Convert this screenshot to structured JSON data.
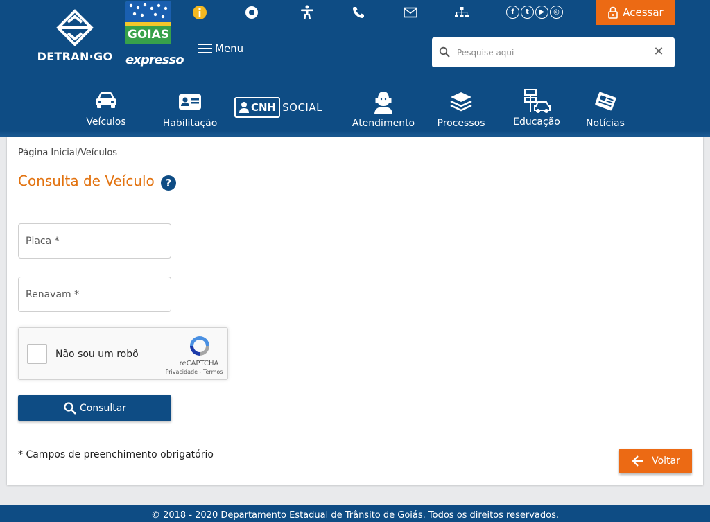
{
  "header": {
    "logo_detran_text": "DETRAN·GO",
    "logo_goias_text": "GOIAS",
    "logo_expresso_text": "expresso",
    "menu_label": "Menu",
    "acessar_label": "Acessar",
    "search": {
      "placeholder": "Pesquise aqui",
      "value": ""
    },
    "top_icons": [
      "info-icon",
      "location-icon",
      "accessibility-icon",
      "phone-icon",
      "mail-icon",
      "sitemap-icon"
    ],
    "social": [
      {
        "name": "facebook-icon",
        "glyph": "f"
      },
      {
        "name": "twitter-icon",
        "glyph": "t"
      },
      {
        "name": "youtube-icon",
        "glyph": "▶"
      },
      {
        "name": "instagram-icon",
        "glyph": "◎"
      }
    ],
    "nav": [
      {
        "label": "Veículos",
        "icon": "car-icon"
      },
      {
        "label": "Habilitação",
        "icon": "id-card-icon"
      },
      {
        "label": "CNH",
        "icon": "cnh-social-icon"
      },
      {
        "label": "SOCIAL",
        "icon": ""
      },
      {
        "label": "Atendimento",
        "icon": "attendant-icon"
      },
      {
        "label": "Processos",
        "icon": "layers-icon"
      },
      {
        "label": "Educação",
        "icon": "traffic-education-icon"
      },
      {
        "label": "Notícias",
        "icon": "newspaper-icon"
      }
    ]
  },
  "content": {
    "breadcrumb": "Página Inicial/Veículos",
    "title": "Consulta de Veículo",
    "help_glyph": "?",
    "fields": {
      "placa_placeholder": "Placa *",
      "renavam_placeholder": "Renavam *"
    },
    "recaptcha": {
      "label": "Não sou um robô",
      "brand": "reCAPTCHA",
      "terms": "Privacidade - Termos"
    },
    "consultar_label": "Consultar",
    "required_note": "* Campos de preenchimento obrigatório",
    "voltar_label": "Voltar"
  },
  "footer": {
    "text": "© 2018 - 2020 Departamento Estadual de Trânsito de Goiás. Todos os direitos reservados."
  },
  "colors": {
    "brand_blue": "#0e4c84",
    "accent_orange": "#ec6a14",
    "title_orange": "#e2720f"
  }
}
